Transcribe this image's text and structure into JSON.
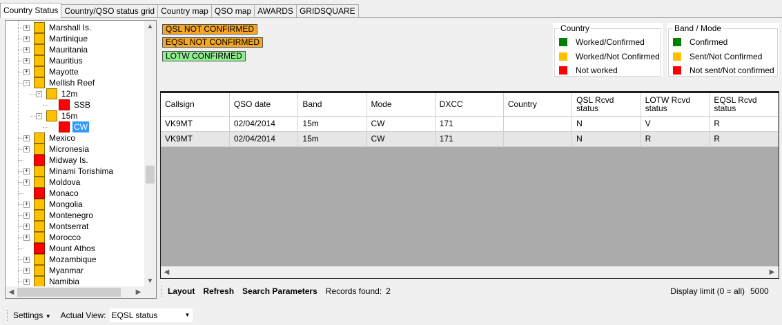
{
  "tabs": [
    {
      "label": "Country Status",
      "active": true
    },
    {
      "label": "Country/QSO status grid",
      "active": false
    },
    {
      "label": "Country map",
      "active": false
    },
    {
      "label": "QSO map",
      "active": false
    },
    {
      "label": "AWARDS",
      "active": false
    },
    {
      "label": "GRIDSQUARE",
      "active": false
    }
  ],
  "tree": {
    "items": [
      {
        "label": "Marshall Is.",
        "level": 0,
        "expander": "+",
        "color": "#ffc000"
      },
      {
        "label": "Martinique",
        "level": 0,
        "expander": "+",
        "color": "#ffc000"
      },
      {
        "label": "Mauritania",
        "level": 0,
        "expander": "+",
        "color": "#ffc000"
      },
      {
        "label": "Mauritius",
        "level": 0,
        "expander": "+",
        "color": "#ffc000"
      },
      {
        "label": "Mayotte",
        "level": 0,
        "expander": "+",
        "color": "#ffc000"
      },
      {
        "label": "Mellish Reef",
        "level": 0,
        "expander": "-",
        "color": "#ffc000"
      },
      {
        "label": "12m",
        "level": 1,
        "expander": "-",
        "color": "#ffc000"
      },
      {
        "label": "SSB",
        "level": 2,
        "expander": "",
        "color": "#ff0000"
      },
      {
        "label": "15m",
        "level": 1,
        "expander": "-",
        "color": "#ffc000"
      },
      {
        "label": "CW",
        "level": 2,
        "expander": "",
        "color": "#ff0000",
        "selected": true
      },
      {
        "label": "Mexico",
        "level": 0,
        "expander": "+",
        "color": "#ffc000"
      },
      {
        "label": "Micronesia",
        "level": 0,
        "expander": "+",
        "color": "#ffc000"
      },
      {
        "label": "Midway Is.",
        "level": 0,
        "expander": "",
        "color": "#ff0000"
      },
      {
        "label": "Minami Torishima",
        "level": 0,
        "expander": "+",
        "color": "#ffc000"
      },
      {
        "label": "Moldova",
        "level": 0,
        "expander": "+",
        "color": "#ffc000"
      },
      {
        "label": "Monaco",
        "level": 0,
        "expander": "",
        "color": "#ff0000"
      },
      {
        "label": "Mongolia",
        "level": 0,
        "expander": "+",
        "color": "#ffc000"
      },
      {
        "label": "Montenegro",
        "level": 0,
        "expander": "+",
        "color": "#ffc000"
      },
      {
        "label": "Montserrat",
        "level": 0,
        "expander": "+",
        "color": "#ffc000"
      },
      {
        "label": "Morocco",
        "level": 0,
        "expander": "+",
        "color": "#ffc000"
      },
      {
        "label": "Mount Athos",
        "level": 0,
        "expander": "",
        "color": "#ff0000"
      },
      {
        "label": "Mozambique",
        "level": 0,
        "expander": "+",
        "color": "#ffc000"
      },
      {
        "label": "Myanmar",
        "level": 0,
        "expander": "+",
        "color": "#ffc000"
      },
      {
        "label": "Namibia",
        "level": 0,
        "expander": "+",
        "color": "#ffc000"
      }
    ]
  },
  "status_labels": {
    "qsl": {
      "text": "QSL NOT CONFIRMED",
      "color": "#f5a623"
    },
    "eqsl": {
      "text": "EQSL NOT CONFIRMED",
      "color": "#f5a623"
    },
    "lotw": {
      "text": "LOTW CONFIRMED",
      "color": "#90ee90"
    }
  },
  "legend_country": {
    "title": "Country",
    "items": [
      {
        "label": "Worked/Confirmed",
        "color": "#008000"
      },
      {
        "label": "Worked/Not Confirmed",
        "color": "#ffc000"
      },
      {
        "label": "Not worked",
        "color": "#ff0000"
      }
    ]
  },
  "legend_band": {
    "title": "Band / Mode",
    "items": [
      {
        "label": "Confirmed",
        "color": "#008000"
      },
      {
        "label": "Sent/Not Confirmed",
        "color": "#ffc000"
      },
      {
        "label": "Not sent/Not confirmed",
        "color": "#ff0000"
      }
    ]
  },
  "grid": {
    "columns": [
      {
        "line1": "Callsign",
        "line2": ""
      },
      {
        "line1": "QSO date",
        "line2": ""
      },
      {
        "line1": "Band",
        "line2": ""
      },
      {
        "line1": "Mode",
        "line2": ""
      },
      {
        "line1": "DXCC",
        "line2": ""
      },
      {
        "line1": "Country",
        "line2": ""
      },
      {
        "line1": "QSL Rcvd",
        "line2": "status"
      },
      {
        "line1": "LOTW Rcvd",
        "line2": "status"
      },
      {
        "line1": "EQSL Rcvd",
        "line2": "status"
      }
    ],
    "rows": [
      [
        "VK9MT",
        "02/04/2014",
        "15m",
        "CW",
        "171",
        "",
        "N",
        "V",
        "R"
      ],
      [
        "VK9MT",
        "02/04/2014",
        "15m",
        "CW",
        "171",
        "",
        "N",
        "R",
        "R"
      ]
    ]
  },
  "toolbar": {
    "layout": "Layout",
    "refresh": "Refresh",
    "search": "Search Parameters",
    "records_label": "Records found:",
    "records_count": "2",
    "limit_label": "Display limit (0 = all)",
    "limit_value": "5000"
  },
  "statusbar": {
    "settings": "Settings",
    "actual_view_label": "Actual View:",
    "actual_view_value": "EQSL status"
  }
}
